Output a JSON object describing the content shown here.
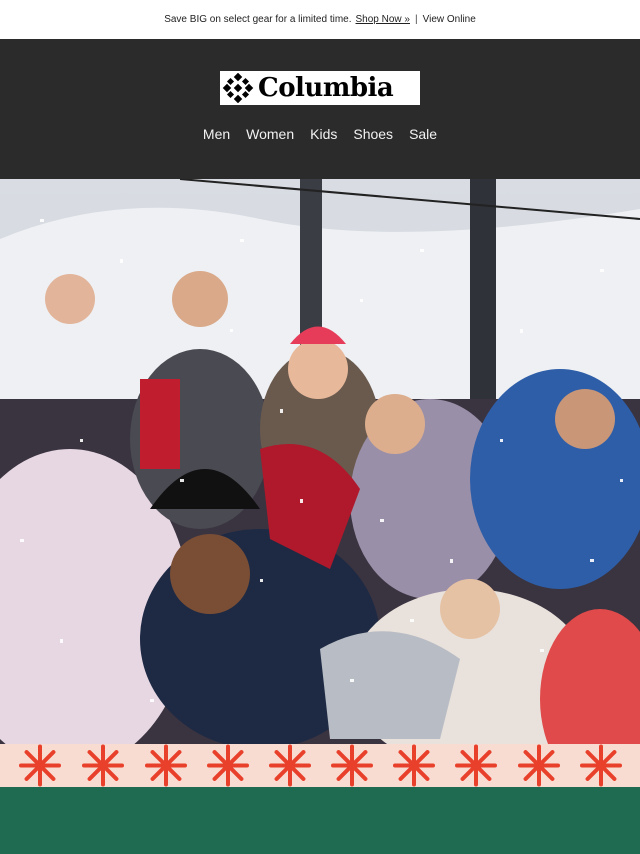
{
  "preheader": {
    "promo_text": "Save BIG on select gear for a limited time.",
    "shop_link": "Shop Now »",
    "separator": "|",
    "view_online": "View Online"
  },
  "header": {
    "logo_text": "Columbia",
    "nav": [
      "Men",
      "Women",
      "Kids",
      "Shoes",
      "Sale"
    ]
  },
  "hero": {
    "alt": "group of people celebrating in the snow with confetti"
  },
  "colors": {
    "header_bg": "#2b2b2b",
    "band_bg": "#f8dcd2",
    "band_star": "#e8402a",
    "footer_bg": "#1e6b52"
  },
  "icons": {
    "logo_mark": "columbia-diamond-icon",
    "band_pattern": "asterisk-star-icon"
  }
}
